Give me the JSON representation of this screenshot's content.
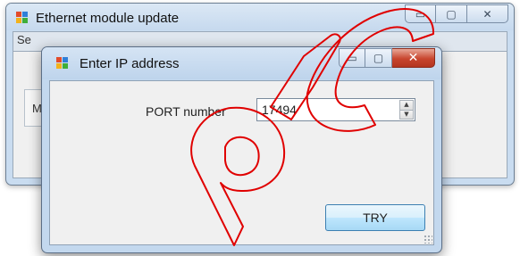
{
  "back_window": {
    "title": "Ethernet module update",
    "tab_label": "Se",
    "group_label": "M",
    "minimize_glyph": "▭",
    "maximize_glyph": "▢",
    "close_glyph": "✕"
  },
  "dialog": {
    "title": "Enter IP address",
    "minimize_glyph": "▭",
    "maximize_glyph": "▢",
    "close_glyph": "✕",
    "port_label": "PORT number",
    "port_value": "17494",
    "spin_up": "▲",
    "spin_down": "▼",
    "try_label": "TRY"
  },
  "watermark": {
    "text": "plc",
    "color": "#ff0000"
  },
  "icons": {
    "app_icon": "windows-form-icon",
    "resize_grip": "resize-grip-icon"
  }
}
